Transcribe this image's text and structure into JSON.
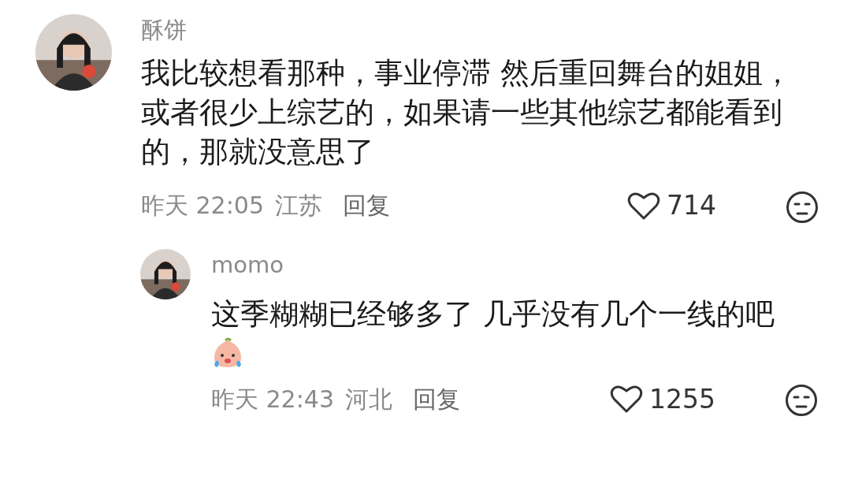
{
  "comments": [
    {
      "user": "酥饼",
      "avatar": {
        "kind": "picture"
      },
      "text_lines": [
        "我比较想看那种，事业停滞 然后重回舞台的姐姐，",
        "或者很少上综艺的，如果请一些其他综艺都能看到",
        "的，那就没意思了"
      ],
      "has_sticker": false,
      "time": "昨天 22:05",
      "location": "江苏",
      "reply_label": "回复",
      "likes": "714",
      "liked": false,
      "is_reply": false
    },
    {
      "user": "momo",
      "avatar": {
        "kind": "picture"
      },
      "text_lines": [
        "这季糊糊已经够多了 几乎没有几个一线的吧"
      ],
      "has_sticker": true,
      "time": "昨天 22:43",
      "location": "河北",
      "reply_label": "回复",
      "likes": "1255",
      "liked": false,
      "is_reply": true
    }
  ]
}
